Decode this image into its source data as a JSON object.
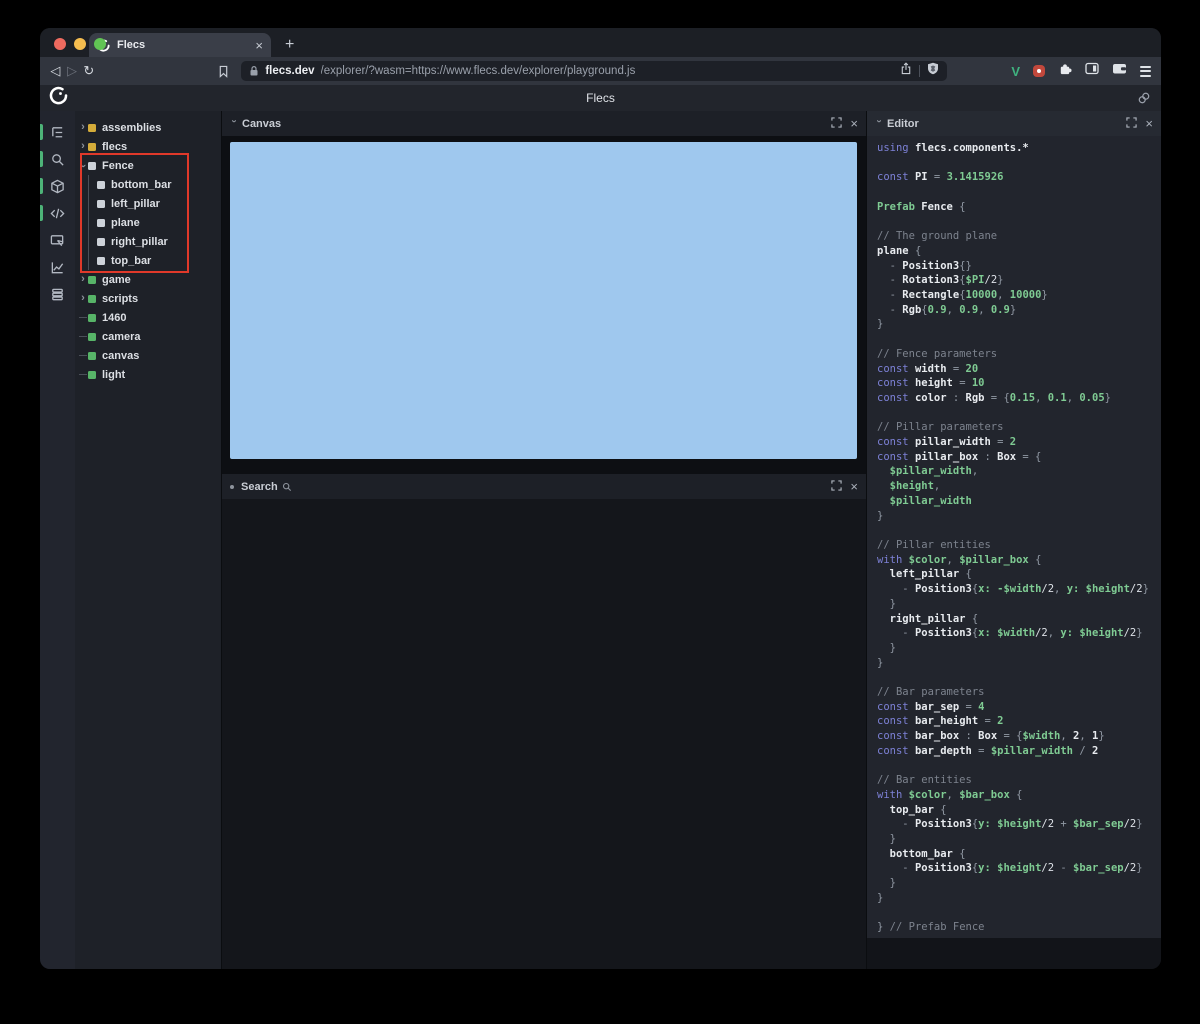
{
  "browser": {
    "traffic_lights": [
      "#ee6a5f",
      "#f5bd4f",
      "#61c354"
    ],
    "tab": {
      "title": "Flecs",
      "close_glyph": "×",
      "new_tab_glyph": "+"
    },
    "toolbar": {
      "back_glyph": "◁",
      "forward_glyph": "▷",
      "reload_glyph": "↻",
      "url_host": "flecs.dev",
      "url_rest": "/explorer/?wasm=https://www.flecs.dev/explorer/playground.js"
    },
    "icons": [
      "bookmark-icon",
      "lock-icon",
      "share-icon",
      "brave-shield-icon",
      "vue-devtools-icon",
      "extension-red-icon",
      "extensions-puzzle-icon",
      "sidebar-icon",
      "wallet-icon",
      "menu-icon"
    ]
  },
  "app": {
    "title": "Flecs",
    "logo": "flecs-logo",
    "header_link": "link-icon"
  },
  "rail": {
    "items": [
      {
        "name": "entity-tree",
        "active": true
      },
      {
        "name": "search",
        "active": true
      },
      {
        "name": "scene-canvas",
        "active": true
      },
      {
        "name": "script-editor",
        "active": true
      },
      {
        "name": "inspector",
        "active": false
      },
      {
        "name": "stats",
        "active": false
      },
      {
        "name": "commands",
        "active": false
      }
    ]
  },
  "tree": {
    "annotation_color": "#e0392a",
    "items": [
      {
        "label": "assemblies",
        "color": "#d4ac3a",
        "state": "collapsed"
      },
      {
        "label": "flecs",
        "color": "#d4ac3a",
        "state": "collapsed"
      },
      {
        "label": "Fence",
        "color": "#cdd2d9",
        "state": "expanded"
      },
      {
        "label": "bottom_bar",
        "color": "#cdd2d9",
        "state": "child"
      },
      {
        "label": "left_pillar",
        "color": "#cdd2d9",
        "state": "child"
      },
      {
        "label": "plane",
        "color": "#cdd2d9",
        "state": "child"
      },
      {
        "label": "right_pillar",
        "color": "#cdd2d9",
        "state": "child"
      },
      {
        "label": "top_bar",
        "color": "#cdd2d9",
        "state": "child"
      },
      {
        "label": "game",
        "color": "#57b468",
        "state": "collapsed"
      },
      {
        "label": "scripts",
        "color": "#57b468",
        "state": "collapsed"
      },
      {
        "label": "1460",
        "color": "#57b468",
        "state": "leaf"
      },
      {
        "label": "camera",
        "color": "#57b468",
        "state": "leaf"
      },
      {
        "label": "canvas",
        "color": "#57b468",
        "state": "leaf"
      },
      {
        "label": "light",
        "color": "#57b468",
        "state": "leaf"
      }
    ]
  },
  "panels": {
    "canvas": {
      "title": "Canvas",
      "viewport_color": "#9fc8ee"
    },
    "search": {
      "title": "Search"
    },
    "editor": {
      "title": "Editor"
    }
  },
  "editor": {
    "code_lines": [
      [
        [
          "k",
          "using "
        ],
        [
          "i",
          "flecs.components.*"
        ]
      ],
      [],
      [
        [
          "k",
          "const "
        ],
        [
          "i",
          "PI"
        ],
        [
          "p",
          " = "
        ],
        [
          "g",
          "3.1415926"
        ]
      ],
      [],
      [
        [
          "g",
          "Prefab "
        ],
        [
          "i",
          "Fence "
        ],
        [
          "p",
          "{"
        ]
      ],
      [],
      [
        [
          "c",
          "// The ground plane"
        ]
      ],
      [
        [
          "i",
          "plane "
        ],
        [
          "p",
          "{"
        ]
      ],
      [
        [
          "p",
          "  - "
        ],
        [
          "i",
          "Position3"
        ],
        [
          "p",
          "{}"
        ]
      ],
      [
        [
          "p",
          "  - "
        ],
        [
          "i",
          "Rotation3"
        ],
        [
          "p",
          "{"
        ],
        [
          "g",
          "$PI"
        ],
        [
          "w",
          "/2"
        ],
        [
          "p",
          "}"
        ]
      ],
      [
        [
          "p",
          "  - "
        ],
        [
          "i",
          "Rectangle"
        ],
        [
          "p",
          "{"
        ],
        [
          "g",
          "10000"
        ],
        [
          "p",
          ", "
        ],
        [
          "g",
          "10000"
        ],
        [
          "p",
          "}"
        ]
      ],
      [
        [
          "p",
          "  - "
        ],
        [
          "i",
          "Rgb"
        ],
        [
          "p",
          "{"
        ],
        [
          "g",
          "0.9"
        ],
        [
          "p",
          ", "
        ],
        [
          "g",
          "0.9"
        ],
        [
          "p",
          ", "
        ],
        [
          "g",
          "0.9"
        ],
        [
          "p",
          "}"
        ]
      ],
      [
        [
          "p",
          "}"
        ]
      ],
      [],
      [
        [
          "c",
          "// Fence parameters"
        ]
      ],
      [
        [
          "k",
          "const "
        ],
        [
          "i",
          "width"
        ],
        [
          "p",
          " = "
        ],
        [
          "g",
          "20"
        ]
      ],
      [
        [
          "k",
          "const "
        ],
        [
          "i",
          "height"
        ],
        [
          "p",
          " = "
        ],
        [
          "g",
          "10"
        ]
      ],
      [
        [
          "k",
          "const "
        ],
        [
          "i",
          "color"
        ],
        [
          "p",
          " : "
        ],
        [
          "i",
          "Rgb"
        ],
        [
          "p",
          " = {"
        ],
        [
          "g",
          "0.15"
        ],
        [
          "p",
          ", "
        ],
        [
          "g",
          "0.1"
        ],
        [
          "p",
          ", "
        ],
        [
          "g",
          "0.05"
        ],
        [
          "p",
          "}"
        ]
      ],
      [],
      [
        [
          "c",
          "// Pillar parameters"
        ]
      ],
      [
        [
          "k",
          "const "
        ],
        [
          "i",
          "pillar_width"
        ],
        [
          "p",
          " = "
        ],
        [
          "g",
          "2"
        ]
      ],
      [
        [
          "k",
          "const "
        ],
        [
          "i",
          "pillar_box"
        ],
        [
          "p",
          " : "
        ],
        [
          "i",
          "Box"
        ],
        [
          "p",
          " = {"
        ]
      ],
      [
        [
          "g",
          "  $pillar_width"
        ],
        [
          "p",
          ","
        ]
      ],
      [
        [
          "g",
          "  $height"
        ],
        [
          "p",
          ","
        ]
      ],
      [
        [
          "g",
          "  $pillar_width"
        ]
      ],
      [
        [
          "p",
          "}"
        ]
      ],
      [],
      [
        [
          "c",
          "// Pillar entities"
        ]
      ],
      [
        [
          "k",
          "with "
        ],
        [
          "g",
          "$color"
        ],
        [
          "p",
          ", "
        ],
        [
          "g",
          "$pillar_box "
        ],
        [
          "p",
          "{"
        ]
      ],
      [
        [
          "i",
          "  left_pillar "
        ],
        [
          "p",
          "{"
        ]
      ],
      [
        [
          "p",
          "    - "
        ],
        [
          "i",
          "Position3"
        ],
        [
          "p",
          "{"
        ],
        [
          "g",
          "x: -$width"
        ],
        [
          "w",
          "/2"
        ],
        [
          "p",
          ", "
        ],
        [
          "g",
          "y: $height"
        ],
        [
          "w",
          "/2"
        ],
        [
          "p",
          "}"
        ]
      ],
      [
        [
          "p",
          "  }"
        ]
      ],
      [
        [
          "i",
          "  right_pillar "
        ],
        [
          "p",
          "{"
        ]
      ],
      [
        [
          "p",
          "    - "
        ],
        [
          "i",
          "Position3"
        ],
        [
          "p",
          "{"
        ],
        [
          "g",
          "x: $width"
        ],
        [
          "w",
          "/2"
        ],
        [
          "p",
          ", "
        ],
        [
          "g",
          "y: $height"
        ],
        [
          "w",
          "/2"
        ],
        [
          "p",
          "}"
        ]
      ],
      [
        [
          "p",
          "  }"
        ]
      ],
      [
        [
          "p",
          "}"
        ]
      ],
      [],
      [
        [
          "c",
          "// Bar parameters"
        ]
      ],
      [
        [
          "k",
          "const "
        ],
        [
          "i",
          "bar_sep"
        ],
        [
          "p",
          " = "
        ],
        [
          "g",
          "4"
        ]
      ],
      [
        [
          "k",
          "const "
        ],
        [
          "i",
          "bar_height"
        ],
        [
          "p",
          " = "
        ],
        [
          "g",
          "2"
        ]
      ],
      [
        [
          "k",
          "const "
        ],
        [
          "i",
          "bar_box"
        ],
        [
          "p",
          " : "
        ],
        [
          "i",
          "Box"
        ],
        [
          "p",
          " = {"
        ],
        [
          "g",
          "$width"
        ],
        [
          "p",
          ", "
        ],
        [
          "i",
          "2"
        ],
        [
          "p",
          ", "
        ],
        [
          "i",
          "1"
        ],
        [
          "p",
          "}"
        ]
      ],
      [
        [
          "k",
          "const "
        ],
        [
          "i",
          "bar_depth"
        ],
        [
          "p",
          " = "
        ],
        [
          "g",
          "$pillar_width"
        ],
        [
          "p",
          " / "
        ],
        [
          "i",
          "2"
        ]
      ],
      [],
      [
        [
          "c",
          "// Bar entities"
        ]
      ],
      [
        [
          "k",
          "with "
        ],
        [
          "g",
          "$color"
        ],
        [
          "p",
          ", "
        ],
        [
          "g",
          "$bar_box "
        ],
        [
          "p",
          "{"
        ]
      ],
      [
        [
          "i",
          "  top_bar "
        ],
        [
          "p",
          "{"
        ]
      ],
      [
        [
          "p",
          "    - "
        ],
        [
          "i",
          "Position3"
        ],
        [
          "p",
          "{"
        ],
        [
          "g",
          "y: $height"
        ],
        [
          "w",
          "/2"
        ],
        [
          "p",
          " + "
        ],
        [
          "g",
          "$bar_sep"
        ],
        [
          "w",
          "/2"
        ],
        [
          "p",
          "}"
        ]
      ],
      [
        [
          "p",
          "  }"
        ]
      ],
      [
        [
          "i",
          "  bottom_bar "
        ],
        [
          "p",
          "{"
        ]
      ],
      [
        [
          "p",
          "    - "
        ],
        [
          "i",
          "Position3"
        ],
        [
          "p",
          "{"
        ],
        [
          "g",
          "y: $height"
        ],
        [
          "w",
          "/2"
        ],
        [
          "p",
          " - "
        ],
        [
          "g",
          "$bar_sep"
        ],
        [
          "w",
          "/2"
        ],
        [
          "p",
          "}"
        ]
      ],
      [
        [
          "p",
          "  }"
        ]
      ],
      [
        [
          "p",
          "}"
        ]
      ],
      [],
      [
        [
          "p",
          "} "
        ],
        [
          "c",
          "// Prefab Fence"
        ]
      ]
    ]
  }
}
